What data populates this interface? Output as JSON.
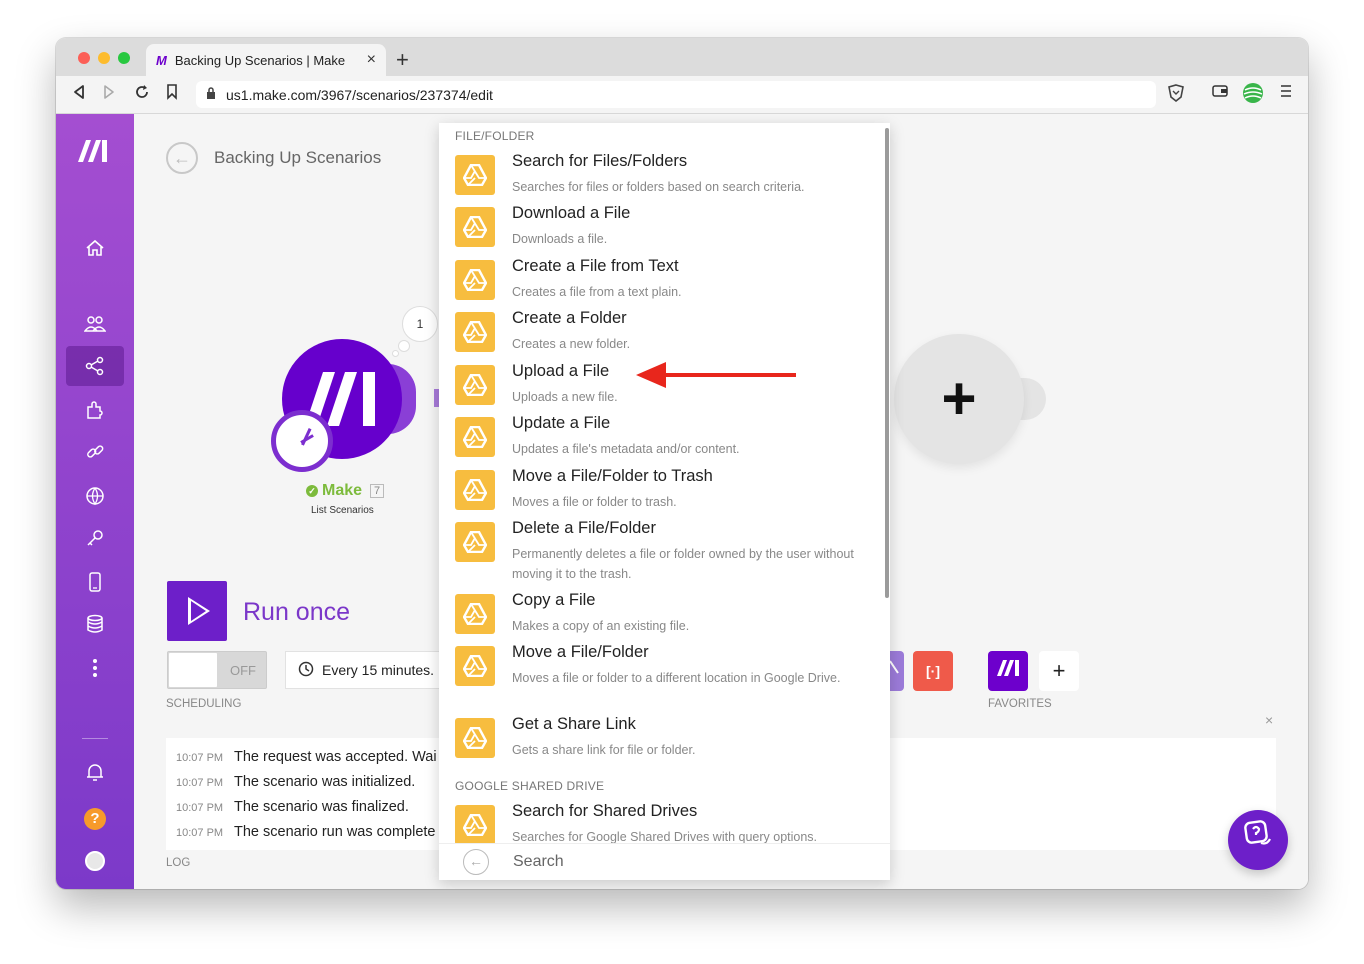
{
  "browser": {
    "tab_title": "Backing Up Scenarios | Make",
    "tab_close": "×",
    "new_tab": "+",
    "url": "us1.make.com/3967/scenarios/237374/edit"
  },
  "header": {
    "back_glyph": "←",
    "scenario_title": "Backing Up Scenarios"
  },
  "sidebar": {
    "logo": "///",
    "items": [
      "home-icon",
      "team-icon",
      "scenarios-icon",
      "apps-icon",
      "connections-icon",
      "webhooks-icon",
      "keys-icon",
      "devices-icon",
      "data-stores-icon",
      "more-icon",
      "notifications-icon",
      "help-icon",
      "avatar"
    ],
    "help_glyph": "?"
  },
  "canvas": {
    "bubble_count": "1",
    "module_title": "Make",
    "module_number": "7",
    "module_subtitle": "List Scenarios",
    "add_glyph": "+"
  },
  "controls": {
    "run_once": "Run once",
    "toggle_off": "OFF",
    "schedule": "Every 15 minutes.",
    "scheduling_label": "SCHEDULING",
    "favorites_label": "FAVORITES",
    "tool_red_glyph": "[·]",
    "fav_add": "+"
  },
  "log": {
    "label": "LOG",
    "close": "×",
    "rows": [
      {
        "time": "10:07 PM",
        "msg": "The request was accepted. Wai"
      },
      {
        "time": "10:07 PM",
        "msg": "The scenario was initialized."
      },
      {
        "time": "10:07 PM",
        "msg": "The scenario was finalized."
      },
      {
        "time": "10:07 PM",
        "msg": "The scenario run was complete"
      }
    ]
  },
  "menu": {
    "section_file_folder": "FILE/FOLDER",
    "section_shared_drive": "GOOGLE SHARED DRIVE",
    "items": [
      {
        "title": "Search for Files/Folders",
        "desc": "Searches for files or folders based on search criteria."
      },
      {
        "title": "Download a File",
        "desc": "Downloads a file."
      },
      {
        "title": "Create a File from Text",
        "desc": "Creates a file from a text plain."
      },
      {
        "title": "Create a Folder",
        "desc": "Creates a new folder."
      },
      {
        "title": "Upload a File",
        "desc": "Uploads a new file."
      },
      {
        "title": "Update a File",
        "desc": "Updates a file's metadata and/or content."
      },
      {
        "title": "Move a File/Folder to Trash",
        "desc": "Moves a file or folder to trash."
      },
      {
        "title": "Delete a File/Folder",
        "desc": "Permanently deletes a file or folder owned by the user without moving it to the trash."
      },
      {
        "title": "Copy a File",
        "desc": "Makes a copy of an existing file."
      },
      {
        "title": "Move a File/Folder",
        "desc": "Moves a file or folder to a different location in Google Drive."
      },
      {
        "title": "Get a Share Link",
        "desc": "Gets a share link for file or folder."
      },
      {
        "title": "Search for Shared Drives",
        "desc": "Searches for Google Shared Drives with query options."
      }
    ],
    "search_placeholder": "Search"
  },
  "colors": {
    "sidebar_top": "#a44ed1",
    "sidebar_bottom": "#7c39c9",
    "brand_purple": "#6d00cc",
    "drive_icon_bg": "#f7bd3f",
    "annotation_arrow": "#e8261c"
  }
}
